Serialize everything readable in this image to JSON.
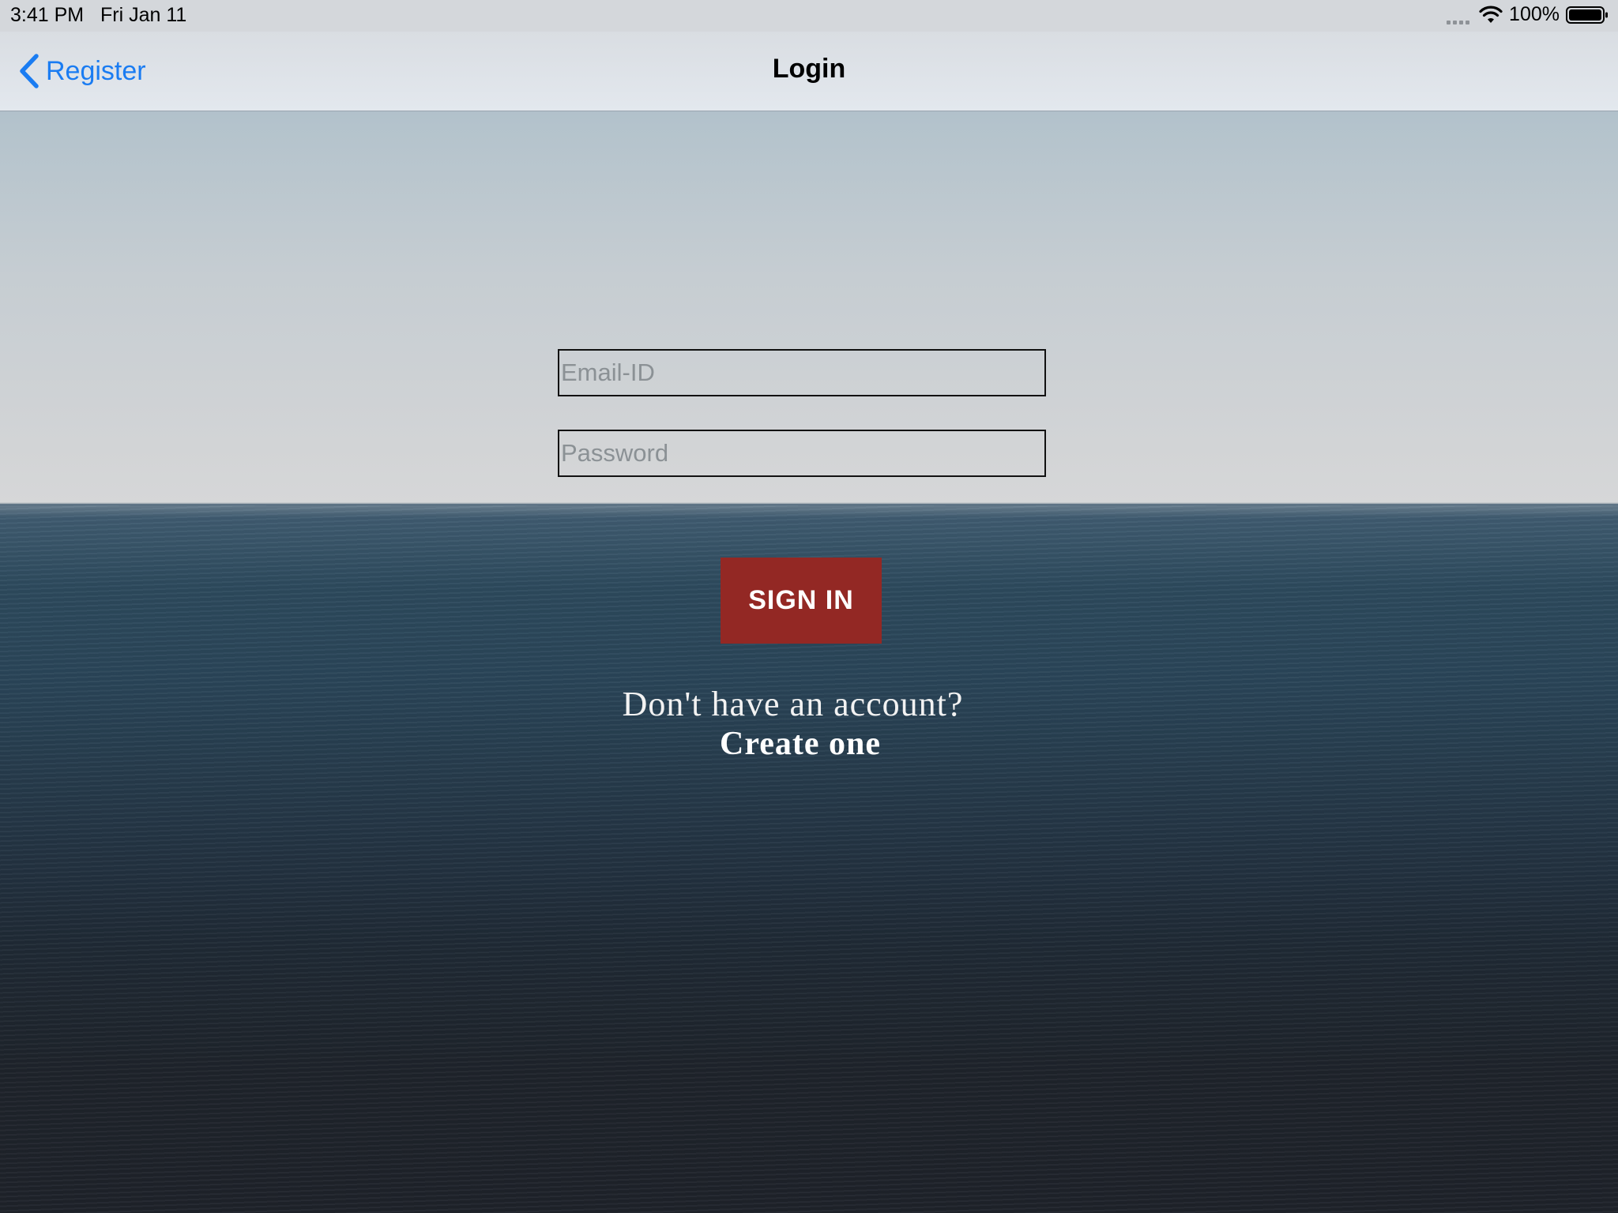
{
  "status_bar": {
    "time": "3:41 PM",
    "date": "Fri Jan 11",
    "battery": "100%",
    "icons": [
      "cellular-signal-icon",
      "wifi-icon",
      "battery-icon"
    ]
  },
  "nav_bar": {
    "back_label": "Register",
    "title": "Login",
    "accent_color": "#1a7cf2"
  },
  "form": {
    "email": {
      "placeholder": "Email-ID",
      "value": ""
    },
    "password": {
      "placeholder": "Password",
      "value": ""
    },
    "submit_label": "SIGN IN",
    "submit_color": "#932824"
  },
  "footer": {
    "prompt": "Don't have an account?",
    "link": "Create one"
  }
}
